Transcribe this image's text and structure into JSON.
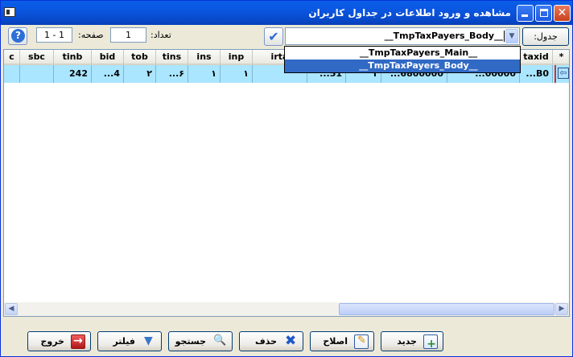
{
  "window": {
    "title": "مشاهده و ورود اطلاعات در جداول کاربران"
  },
  "toolbar": {
    "help_icon": "?",
    "range_value": "1 - 1",
    "page_label": "صفحه:",
    "page_value": "1",
    "count_label": "تعداد:",
    "check_icon": "✔",
    "table_selected": "__TmpTaxPayers_Body__",
    "table_button_label": "جدول:"
  },
  "dropdown": {
    "options": [
      "__TmpTaxPayers_Main__",
      "__TmpTaxPayers_Body__"
    ],
    "selected_index": 1
  },
  "grid": {
    "columns": [
      "c",
      "sbc",
      "tinb",
      "bid",
      "tob",
      "tins",
      "ins",
      "inp",
      "irta",
      "",
      "",
      "",
      "",
      "taxid",
      "*"
    ],
    "row": [
      "",
      "",
      "242",
      "...4",
      "۲",
      "...۶",
      "۱",
      "۱",
      "",
      "...51",
      "۱",
      "...6800000",
      "...00000",
      "...B0"
    ],
    "row_indicator": "⇦"
  },
  "buttons": {
    "new": "جدید",
    "edit": "اصلاح",
    "delete": "حذف",
    "search": "جستجو",
    "filter": "فیلتر",
    "exit": "خروج"
  }
}
